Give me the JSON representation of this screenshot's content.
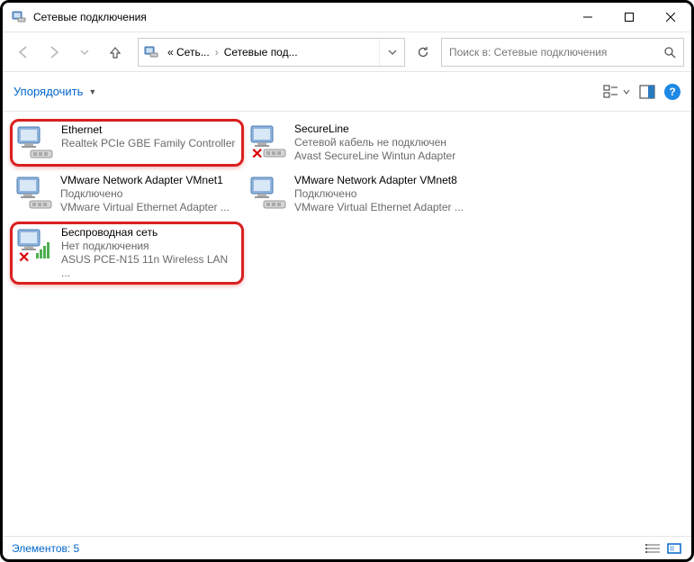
{
  "window": {
    "title": "Сетевые подключения"
  },
  "nav": {
    "crumb1": "« Сеть...",
    "crumb2": "Сетевые под...",
    "search_placeholder": "Поиск в: Сетевые подключения"
  },
  "toolbar": {
    "organize": "Упорядочить"
  },
  "connections": [
    {
      "name": "Ethernet",
      "status": "",
      "device": "Realtek PCIe GBE Family Controller",
      "icon_type": "ethernet",
      "disconnected": false,
      "highlight": true
    },
    {
      "name": "SecureLine",
      "status": "Сетевой кабель не подключен",
      "device": "Avast SecureLine Wintun Adapter",
      "icon_type": "ethernet",
      "disconnected": true,
      "highlight": false
    },
    {
      "name": "VMware Network Adapter VMnet1",
      "status": "Подключено",
      "device": "VMware Virtual Ethernet Adapter ...",
      "icon_type": "ethernet",
      "disconnected": false,
      "highlight": false
    },
    {
      "name": "VMware Network Adapter VMnet8",
      "status": "Подключено",
      "device": "VMware Virtual Ethernet Adapter ...",
      "icon_type": "ethernet",
      "disconnected": false,
      "highlight": false
    },
    {
      "name": "Беспроводная сеть",
      "status": "Нет подключения",
      "device": "ASUS PCE-N15 11n Wireless LAN ...",
      "icon_type": "wifi",
      "disconnected": true,
      "highlight": true
    }
  ],
  "statusbar": {
    "count_label": "Элементов: 5"
  }
}
